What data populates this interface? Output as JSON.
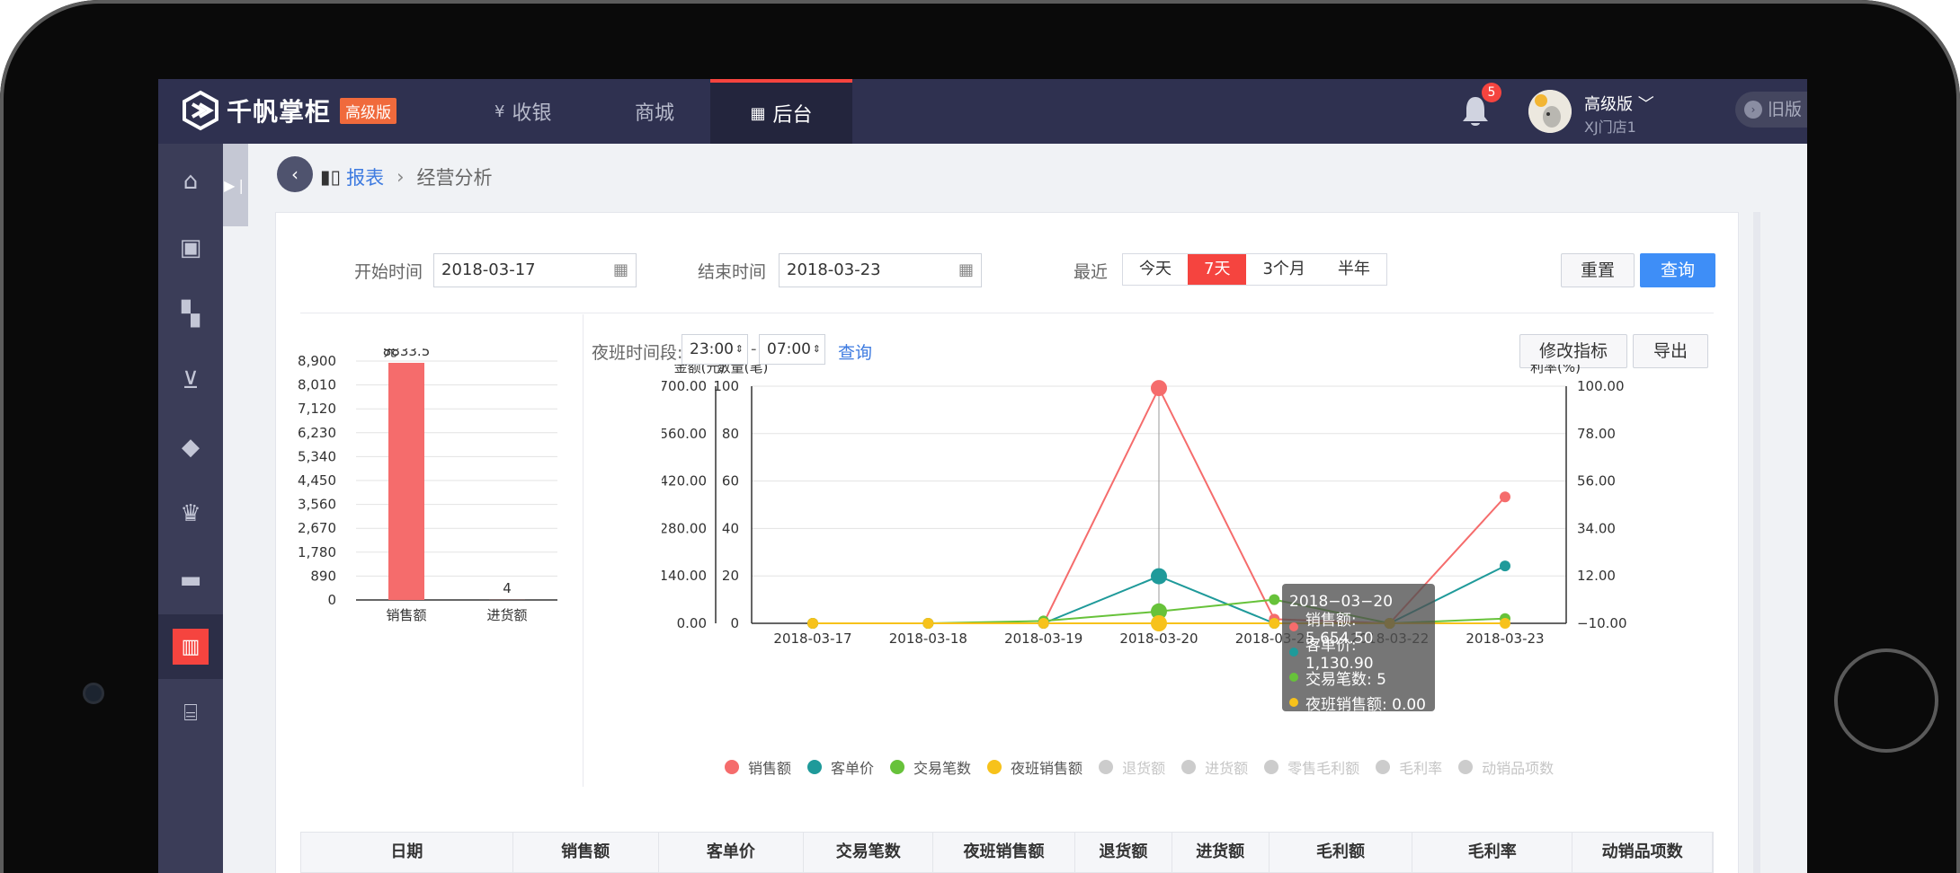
{
  "app": {
    "logo_text": "千帆掌柜",
    "logo_badge": "高级版",
    "nav": [
      {
        "label": "收银",
        "icon": "yen-coin-icon"
      },
      {
        "label": "商城",
        "icon": ""
      },
      {
        "label": "后台",
        "icon": "grid-icon"
      }
    ],
    "notifications": "5",
    "user_role": "高级版",
    "user_store": "XJ门店1",
    "old_version": "旧版"
  },
  "sidebar": {
    "items": [
      "home-icon",
      "bag-icon",
      "apps-icon",
      "cart-icon",
      "tag-icon",
      "crown-icon",
      "ticket-icon",
      "report-icon",
      "store-icon"
    ],
    "active_index": 7
  },
  "breadcrumb": {
    "section": "报表",
    "page": "经营分析"
  },
  "filters": {
    "start_label": "开始时间",
    "start_value": "2018-03-17",
    "end_label": "结束时间",
    "end_value": "2018-03-23",
    "recent_label": "最近",
    "ranges": [
      "今天",
      "7天",
      "3个月",
      "半年"
    ],
    "active_range": "7天",
    "reset": "重置",
    "query": "查询"
  },
  "night_shift": {
    "label": "夜班时间段:",
    "start": "23:00",
    "dash": "-",
    "end": "07:00",
    "query": "查询",
    "modify": "修改指标",
    "export": "导出"
  },
  "chart_data": [
    {
      "type": "bar",
      "ylabel": "元",
      "categories": [
        "销售额",
        "进货额"
      ],
      "values": [
        8833.5,
        4
      ],
      "value_labels": [
        "8833.5",
        "4"
      ],
      "ylim": [
        0,
        8900
      ],
      "yticks": [
        "0",
        "890",
        "1,780",
        "2,670",
        "3,560",
        "4,450",
        "5,340",
        "6,230",
        "7,120",
        "8,010",
        "8,900"
      ],
      "color": "#f56c6c"
    },
    {
      "type": "line",
      "x": [
        "2018-03-17",
        "2018-03-18",
        "2018-03-19",
        "2018-03-20",
        "2018-03-21",
        "2018-03-22",
        "2018-03-23"
      ],
      "axes": {
        "amount": {
          "label": "金额(元)",
          "ylim": [
            0,
            5700
          ],
          "ticks": [
            "0.00",
            "1140.00",
            "2280.00",
            "3420.00",
            "4560.00",
            "5700.00"
          ]
        },
        "count": {
          "label": "数量(笔)",
          "ylim": [
            0,
            100
          ],
          "ticks": [
            "0",
            "20",
            "40",
            "60",
            "80",
            "100"
          ]
        },
        "rate": {
          "label": "利率(%)",
          "ylim": [
            -10,
            100
          ],
          "ticks": [
            "−10.00",
            "12.00",
            "34.00",
            "56.00",
            "78.00",
            "100.00"
          ]
        }
      },
      "series": [
        {
          "name": "销售额",
          "color": "#f56c6c",
          "axis": "amount",
          "values": [
            0,
            0,
            0,
            5654.5,
            100,
            0,
            3040
          ]
        },
        {
          "name": "客单价",
          "color": "#1f9a9a",
          "axis": "amount",
          "values": [
            0,
            0,
            0,
            1130.9,
            0,
            0,
            1380
          ]
        },
        {
          "name": "交易笔数",
          "color": "#67c23a",
          "axis": "count",
          "values": [
            0,
            0,
            1,
            5,
            10,
            0,
            2
          ]
        },
        {
          "name": "夜班销售额",
          "color": "#f7c21b",
          "axis": "amount",
          "values": [
            0,
            0,
            0,
            0,
            0,
            0,
            0
          ]
        }
      ],
      "legend_off": [
        "退货额",
        "进货额",
        "零售毛利额",
        "毛利率",
        "动销品项数"
      ],
      "legend_position": "bottom",
      "highlight_index": 3
    }
  ],
  "tooltip": {
    "date": "2018−03−20",
    "rows": [
      {
        "label": "销售额: 5,654.50",
        "color": "#f56c6c"
      },
      {
        "label": "客单价: 1,130.90",
        "color": "#1f9a9a"
      },
      {
        "label": "交易笔数: 5",
        "color": "#67c23a"
      },
      {
        "label": "夜班销售额: 0.00",
        "color": "#f7c21b"
      }
    ]
  },
  "table": {
    "headers": [
      "日期",
      "销售额",
      "客单价",
      "交易笔数",
      "夜班销售额",
      "退货额",
      "进货额",
      "毛利额",
      "毛利率",
      "动销品项数"
    ]
  }
}
